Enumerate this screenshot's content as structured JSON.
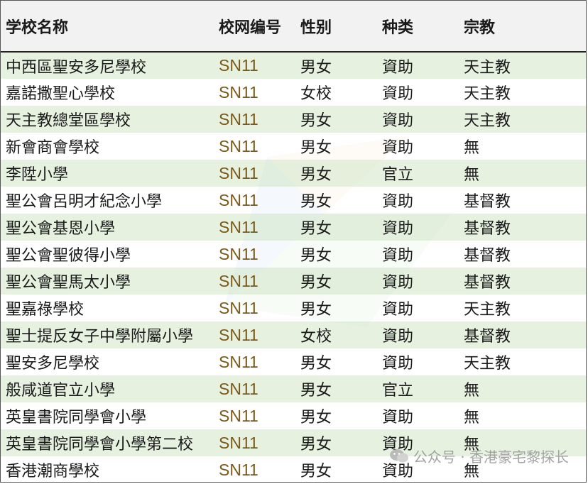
{
  "table": {
    "headers": [
      "学校名称",
      "校网编号",
      "性别",
      "种类",
      "宗教"
    ],
    "rows": [
      [
        "中西區聖安多尼學校",
        "SN11",
        "男女",
        "資助",
        "天主教"
      ],
      [
        "嘉諾撒聖心學校",
        "SN11",
        "女校",
        "資助",
        "天主教"
      ],
      [
        "天主教總堂區學校",
        "SN11",
        "男女",
        "資助",
        "天主教"
      ],
      [
        "新會商會學校",
        "SN11",
        "男女",
        "資助",
        "無"
      ],
      [
        "李陞小學",
        "SN11",
        "男女",
        "官立",
        "無"
      ],
      [
        "聖公會呂明才紀念小學",
        "SN11",
        "男女",
        "資助",
        "基督教"
      ],
      [
        "聖公會基恩小學",
        "SN11",
        "男女",
        "資助",
        "基督教"
      ],
      [
        "聖公會聖彼得小學",
        "SN11",
        "男女",
        "資助",
        "基督教"
      ],
      [
        "聖公會聖馬太小學",
        "SN11",
        "男女",
        "資助",
        "基督教"
      ],
      [
        "聖嘉祿學校",
        "SN11",
        "男女",
        "資助",
        "天主教"
      ],
      [
        "聖士提反女子中學附屬小學",
        "SN11",
        "女校",
        "資助",
        "基督教"
      ],
      [
        "聖安多尼學校",
        "SN11",
        "男女",
        "資助",
        "天主教"
      ],
      [
        "般咸道官立小學",
        "SN11",
        "男女",
        "官立",
        "無"
      ],
      [
        "英皇書院同學會小學",
        "SN11",
        "男女",
        "資助",
        "無"
      ],
      [
        "英皇書院同學會小學第二校",
        "SN11",
        "男女",
        "資助",
        "無"
      ],
      [
        "香港潮商學校",
        "SN11",
        "男女",
        "資助",
        "無"
      ]
    ]
  },
  "watermark": {
    "text": "公众号 · 香港豪宅黎探长",
    "icon": "wechat-icon"
  },
  "colors": {
    "row_band": "#e2efda",
    "header_bg": "#f2f2f2",
    "code_text": "#7a5a1a",
    "logo_blue": "#2f7fd1",
    "logo_green": "#5bb85b",
    "logo_orange": "#f0a23a"
  }
}
